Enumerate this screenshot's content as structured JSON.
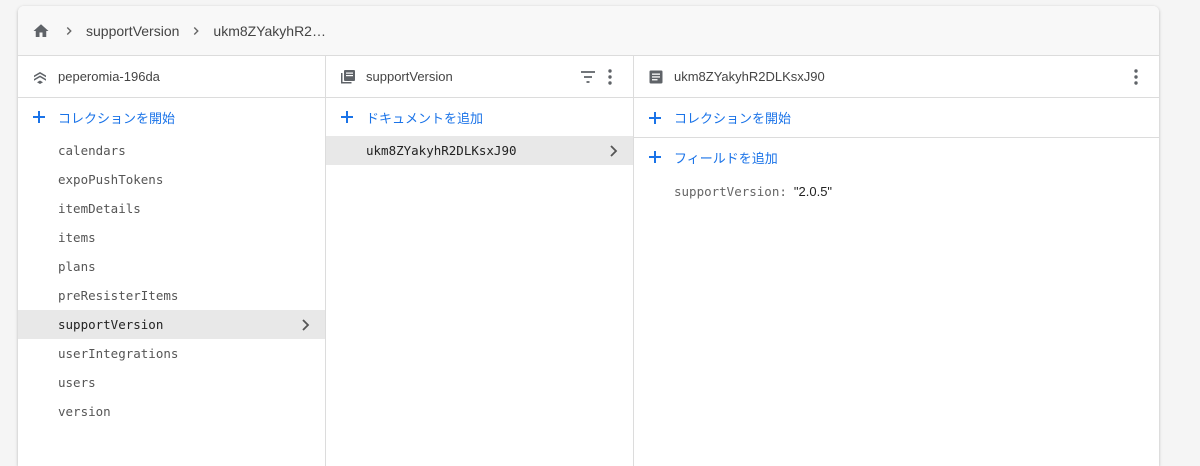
{
  "colors": {
    "accent": "#1a73e8",
    "selected_bg": "#e8e8e8",
    "border": "#dcdcdc"
  },
  "breadcrumb": {
    "home_icon": "home-icon",
    "items": [
      "supportVersion",
      "ukm8ZYakyhR2…"
    ]
  },
  "root_panel": {
    "icon": "firestore-icon",
    "title": "peperomia-196da",
    "add_label": "コレクションを開始",
    "collections": [
      "calendars",
      "expoPushTokens",
      "itemDetails",
      "items",
      "plans",
      "preResisterItems",
      "supportVersion",
      "userIntegrations",
      "users",
      "version"
    ],
    "selected": "supportVersion"
  },
  "collection_panel": {
    "icon": "collection-icon",
    "title": "supportVersion",
    "add_label": "ドキュメントを追加",
    "documents": [
      "ukm8ZYakyhR2DLKsxJ90"
    ],
    "selected": "ukm8ZYakyhR2DLKsxJ90"
  },
  "document_panel": {
    "icon": "document-icon",
    "title": "ukm8ZYakyhR2DLKsxJ90",
    "add_collection_label": "コレクションを開始",
    "add_field_label": "フィールドを追加",
    "fields": [
      {
        "key": "supportVersion",
        "value": "\"2.0.5\""
      }
    ]
  }
}
